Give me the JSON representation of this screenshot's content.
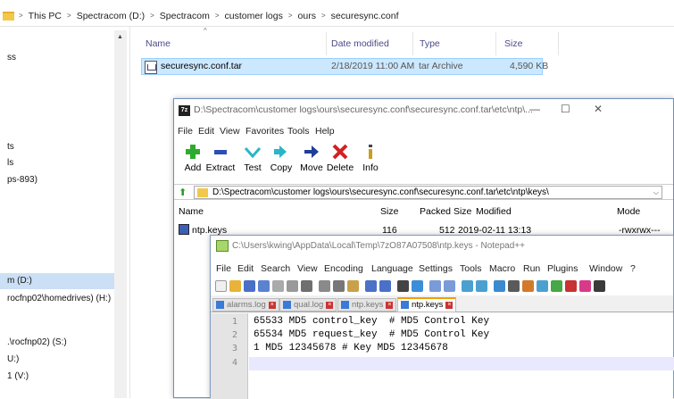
{
  "explorer": {
    "breadcrumbs": [
      "This PC",
      "Spectracom (D:)",
      "Spectracom",
      "customer logs",
      "ours",
      "securesync.conf"
    ],
    "columns": {
      "name": "Name",
      "date": "Date modified",
      "type": "Type",
      "size": "Size"
    },
    "file": {
      "name": "securesync.conf.tar",
      "date": "2/18/2019 11:00 AM",
      "type": "tar Archive",
      "size": "4,590 KB"
    },
    "nav_items": [
      {
        "label": "ss",
        "selected": false
      },
      {
        "label": "ts",
        "selected": false
      },
      {
        "label": "ls",
        "selected": false
      },
      {
        "label": "ps-893)",
        "selected": false
      },
      {
        "label": "m (D:)",
        "selected": true
      },
      {
        "label": "rocfnp02\\homedrives) (H:)",
        "selected": false
      },
      {
        "label": ".\\rocfnp02) (S:)",
        "selected": false
      },
      {
        "label": "U:)",
        "selected": false
      },
      {
        "label": "1 (V:)",
        "selected": false
      }
    ]
  },
  "sevenzip": {
    "title": "D:\\Spectracom\\customer logs\\ours\\securesync.conf\\securesync.conf.tar\\etc\\ntp\\...",
    "app_icon": "7z",
    "menu": [
      "File",
      "Edit",
      "View",
      "Favorites",
      "Tools",
      "Help"
    ],
    "toolbar": [
      "Add",
      "Extract",
      "Test",
      "Copy",
      "Move",
      "Delete",
      "Info"
    ],
    "path": "D:\\Spectracom\\customer logs\\ours\\securesync.conf\\securesync.conf.tar\\etc\\ntp\\keys\\",
    "columns": {
      "name": "Name",
      "size": "Size",
      "packed": "Packed Size",
      "modified": "Modified",
      "mode": "Mode"
    },
    "file": {
      "name": "ntp.keys",
      "size": "116",
      "packed": "512",
      "modified": "2019-02-11 13:13",
      "mode": "-rwxrwx---"
    },
    "window_controls": {
      "minimize": "—",
      "maximize": "☐",
      "close": "✕"
    }
  },
  "notepadpp": {
    "title": "C:\\Users\\kwing\\AppData\\Local\\Temp\\7zO87A07508\\ntp.keys - Notepad++",
    "menu": [
      "File",
      "Edit",
      "Search",
      "View",
      "Encoding",
      "Language",
      "Settings",
      "Tools",
      "Macro",
      "Run",
      "Plugins",
      "Window",
      "?"
    ],
    "tabs": [
      {
        "label": "alarms.log",
        "active": false
      },
      {
        "label": "qual.log",
        "active": false
      },
      {
        "label": "ntp.keys",
        "active": false
      },
      {
        "label": "ntp.keys",
        "active": true
      }
    ],
    "lines": [
      {
        "num": "1",
        "text": "65533 MD5 control_key  # MD5 Control Key"
      },
      {
        "num": "2",
        "text": "65534 MD5 request_key  # MD5 Control Key"
      },
      {
        "num": "3",
        "text": "1 MD5 12345678 # Key MD5 12345678"
      },
      {
        "num": "4",
        "text": ""
      }
    ]
  },
  "colors": {
    "selection": "#cce8ff",
    "nav_selection": "#cce0f5",
    "npp_tab_accent": "#f0a000",
    "current_line": "#e8e8ff"
  }
}
